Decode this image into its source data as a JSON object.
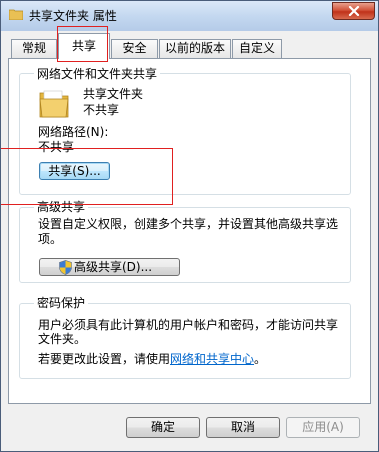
{
  "window": {
    "title": "共享文件夹 属性"
  },
  "tabs": [
    {
      "label": "常规",
      "active": false
    },
    {
      "label": "共享",
      "active": true
    },
    {
      "label": "安全",
      "active": false
    },
    {
      "label": "以前的版本",
      "active": false
    },
    {
      "label": "自定义",
      "active": false
    }
  ],
  "network_sharing": {
    "group_title": "网络文件和文件夹共享",
    "folder_name": "共享文件夹",
    "folder_status": "不共享",
    "path_label": "网络路径(N):",
    "path_value": "不共享",
    "share_button": "共享(S)..."
  },
  "advanced_sharing": {
    "group_title": "高级共享",
    "description_line1": "设置自定义权限，创建多个共享，并设置其他高级共享选",
    "description_line2": "项。",
    "button": "高级共享(D)..."
  },
  "password_protection": {
    "group_title": "密码保护",
    "description_line1": "用户必须具有此计算机的用户帐户和密码，才能访问共享",
    "description_line2": "文件夹。",
    "change_prefix": "若要更改此设置，请使用",
    "link": "网络和共享中心",
    "change_suffix": "。"
  },
  "footer": {
    "ok": "确定",
    "cancel": "取消",
    "apply": "应用(A)"
  },
  "colors": {
    "highlight": "#e02020",
    "link": "#0066cc",
    "titlebar": "#c4d8f0"
  }
}
